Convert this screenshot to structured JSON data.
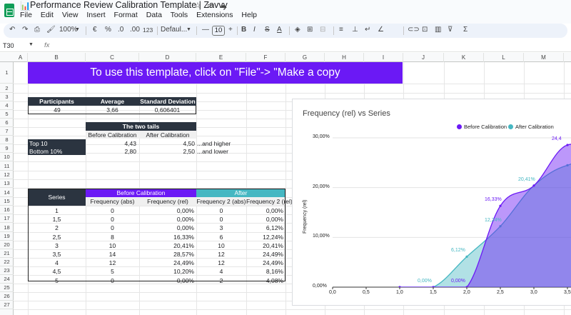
{
  "window": {
    "title": "Performance Review Calibration Template | Zavvy",
    "title_icon": "bar-chart-emoji"
  },
  "menu": [
    "File",
    "Edit",
    "View",
    "Insert",
    "Format",
    "Data",
    "Tools",
    "Extensions",
    "Help"
  ],
  "toolbar": {
    "zoom": "100%",
    "currency": "€",
    "percent": "%",
    "decrease_decimals": ".0",
    "increase_decimals": ".00",
    "number_format": "123",
    "font_name": "Defaul...",
    "font_size": "10"
  },
  "formula_bar": {
    "name_box": "T30",
    "fx": "fx"
  },
  "columns": [
    "A",
    "B",
    "C",
    "D",
    "E",
    "F",
    "G",
    "H",
    "I",
    "J",
    "K",
    "L",
    "M"
  ],
  "rows": [
    "1",
    "2",
    "3",
    "4",
    "5",
    "6",
    "7",
    "8",
    "9",
    "10",
    "11",
    "12",
    "13",
    "14",
    "15",
    "16",
    "17",
    "18",
    "19",
    "20",
    "21",
    "22",
    "23",
    "24",
    "25",
    "26",
    "27"
  ],
  "banner": "To use this template, click on \"File\"-> \"Make a copy",
  "summary": {
    "headers": [
      "Participants",
      "Average",
      "Standard Deviation"
    ],
    "values": [
      "49",
      "3,66",
      "0,606401"
    ]
  },
  "tails": {
    "title": "The two tails",
    "headers": [
      "Before Calibration",
      "After Calibration"
    ],
    "rows": [
      {
        "label": "Top 10",
        "before": "4,43",
        "after": "4,50",
        "note": "...and higher"
      },
      {
        "label": "Bottom 10%",
        "before": "2,80",
        "after": "2,50",
        "note": "...and lower"
      }
    ]
  },
  "freq": {
    "series_header": "Series",
    "before_header": "Before Calibration",
    "after_header": "After",
    "sub_headers": [
      "Frequency (abs)",
      "Frequency (rel)",
      "Frequency 2 (abs)",
      "Frequency 2 (rel)"
    ],
    "rows": [
      [
        "1",
        "0",
        "0,00%",
        "0",
        "0,00%"
      ],
      [
        "1,5",
        "0",
        "0,00%",
        "0",
        "0,00%"
      ],
      [
        "2",
        "0",
        "0,00%",
        "3",
        "6,12%"
      ],
      [
        "2,5",
        "8",
        "16,33%",
        "6",
        "12,24%"
      ],
      [
        "3",
        "10",
        "20,41%",
        "10",
        "20,41%"
      ],
      [
        "3,5",
        "14",
        "28,57%",
        "12",
        "24,49%"
      ],
      [
        "4",
        "12",
        "24,49%",
        "12",
        "24,49%"
      ],
      [
        "4,5",
        "5",
        "10,20%",
        "4",
        "8,16%"
      ],
      [
        "5",
        "0",
        "0,00%",
        "2",
        "4,08%"
      ]
    ]
  },
  "chart_data": {
    "type": "area",
    "title": "Frequency (rel) vs Series",
    "ylabel": "Frequency (rel)",
    "xlabel": "",
    "x_ticks": [
      "0,0",
      "0,5",
      "1,0",
      "1,5",
      "2,0",
      "2,5",
      "3,0",
      "3,5"
    ],
    "y_ticks": [
      "0,00%",
      "10,00%",
      "20,00%",
      "30,00%"
    ],
    "xlim": [
      0,
      3.5
    ],
    "ylim": [
      0,
      30
    ],
    "legend_position": "top-right",
    "x": [
      1,
      1.5,
      2,
      2.5,
      3,
      3.5,
      4,
      4.5,
      5
    ],
    "series": [
      {
        "name": "Before Calibration",
        "color": "#6b19f5",
        "values": [
          0,
          0,
          0,
          16.33,
          20.41,
          28.57,
          24.49,
          10.2,
          0
        ]
      },
      {
        "name": "After Calibration",
        "color": "#45b7c2",
        "values": [
          0,
          0,
          6.12,
          12.24,
          20.41,
          24.49,
          24.49,
          8.16,
          4.08
        ]
      }
    ],
    "visible_data_labels": [
      {
        "series": 1,
        "x": 1.5,
        "text": "0,00%"
      },
      {
        "series": 0,
        "x": 2,
        "text": "0,00%"
      },
      {
        "series": 1,
        "x": 2,
        "text": "6,12%"
      },
      {
        "series": 0,
        "x": 2.5,
        "text": "16,33%"
      },
      {
        "series": 1,
        "x": 2.5,
        "text": "12,24%"
      },
      {
        "series": 1,
        "x": 3,
        "text": "20,41%"
      },
      {
        "series": 0,
        "x": 3.5,
        "text": "24,4"
      }
    ]
  }
}
